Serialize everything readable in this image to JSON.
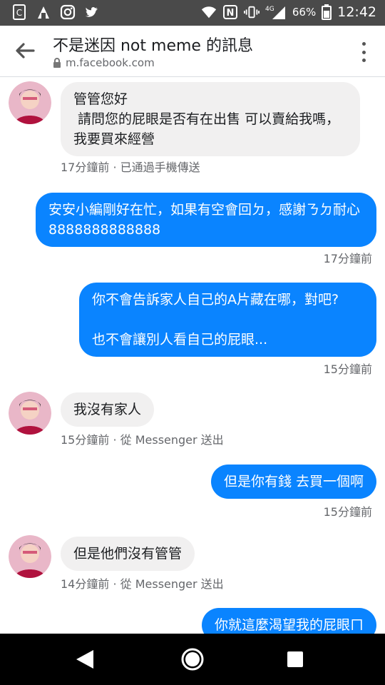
{
  "status_bar": {
    "battery": "66%",
    "network": "4G",
    "time": "12:42",
    "icons": [
      "app-c-icon",
      "android-icon",
      "instagram-icon",
      "twitter-icon",
      "wifi-icon",
      "nfc-icon",
      "vibrate-icon",
      "signal-icon",
      "battery-icon"
    ]
  },
  "header": {
    "title": "不是迷因 not meme 的訊息",
    "url": "m.facebook.com",
    "back_icon": "back-arrow-icon",
    "lock_icon": "lock-icon",
    "menu_icon": "more-vert-icon"
  },
  "messages": [
    {
      "direction": "in",
      "text": "管管您好\n 請問您的屁眼是否有在出售 可以賣給我嗎，我要買來經營",
      "meta": "17分鐘前 · 已通過手機傳送"
    },
    {
      "direction": "out",
      "text": "安安小編剛好在忙，如果有空會回ㄉ，感謝ㄋㄉ耐心 8888888888888",
      "meta": "17分鐘前"
    },
    {
      "direction": "out",
      "text": "你不會告訴家人自己的A片藏在哪，對吧?\n\n也不會讓別人看自己的屁眼...",
      "meta": "15分鐘前"
    },
    {
      "direction": "in",
      "text": "我沒有家人",
      "meta": "15分鐘前 · 從 Messenger 送出"
    },
    {
      "direction": "out",
      "text": "但是你有錢 去買一個啊",
      "meta": "15分鐘前"
    },
    {
      "direction": "in",
      "text": "但是他們沒有管管",
      "meta": "14分鐘前 · 從 Messenger 送出"
    },
    {
      "direction": "out",
      "text": "你就這麼渴望我的屁眼ㄇ",
      "meta": ""
    }
  ],
  "colors": {
    "outgoing_bubble": "#0a84ff",
    "incoming_bubble": "#f1f0f0",
    "status_bar": "#4a4a4a",
    "nav_bar": "#000000"
  },
  "nav_bar": {
    "back_icon": "nav-back-icon",
    "home_icon": "nav-home-icon",
    "recents_icon": "nav-recents-icon"
  }
}
